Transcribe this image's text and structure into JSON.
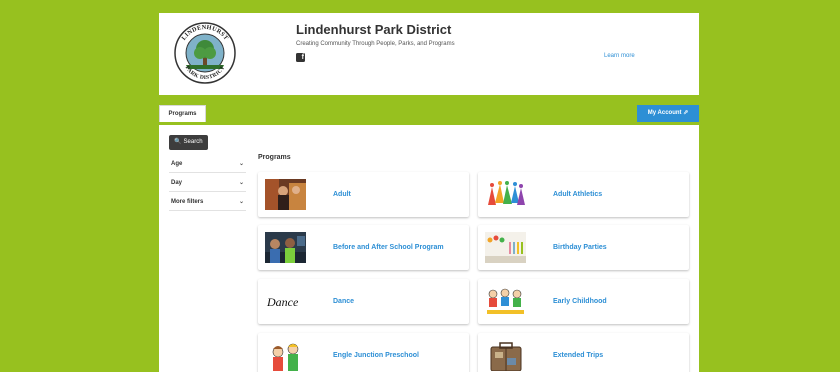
{
  "header": {
    "org_name": "Lindenhurst Park District",
    "tagline": "Creating Community Through People, Parks, and Programs",
    "learn_more": "Learn more",
    "logo_text_top": "LINDENHURST",
    "logo_text_bottom": "PARK DISTRICT"
  },
  "nav": {
    "programs_tab": "Programs",
    "account_button": "My Account ⇗"
  },
  "sidebar": {
    "search_label": "🔍 Search",
    "filters": [
      {
        "label": "Age"
      },
      {
        "label": "Day"
      },
      {
        "label": "More filters"
      }
    ],
    "chevron": "⌄"
  },
  "main": {
    "section_title": "Programs",
    "cards": [
      {
        "label": "Adult",
        "thumb": "adult-photo"
      },
      {
        "label": "Adult Athletics",
        "thumb": "athletics-art"
      },
      {
        "label": "Before and After School Program",
        "thumb": "school-photo"
      },
      {
        "label": "Birthday Parties",
        "thumb": "party-photo"
      },
      {
        "label": "Dance",
        "thumb": "dance-script"
      },
      {
        "label": "Early Childhood",
        "thumb": "kids-drawing"
      },
      {
        "label": "Engle Junction Preschool",
        "thumb": "preschool-art"
      },
      {
        "label": "Extended Trips",
        "thumb": "suitcase-photo"
      }
    ]
  }
}
